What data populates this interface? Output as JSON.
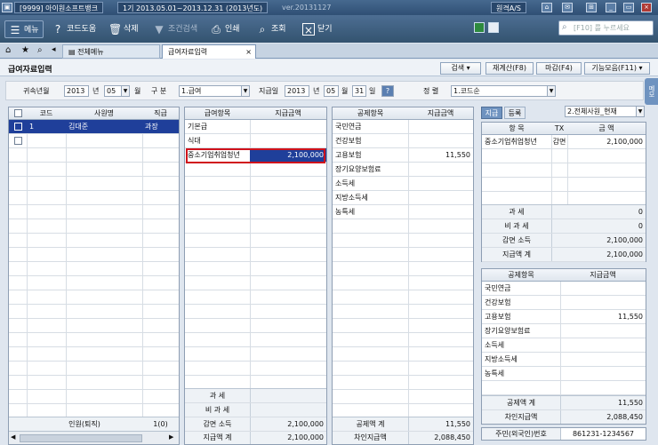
{
  "title_bar": {
    "app_name": "[9999] 아이원소프트뱅크",
    "period": "1기 2013.05.01~2013.12.31 (2013년도)",
    "version": "ver.20131127",
    "support": "원격A/S"
  },
  "toolbar": {
    "menu": "메뉴",
    "code_help": "코드도움",
    "delete": "삭제",
    "condition_search": "조건검색",
    "print": "인쇄",
    "inquiry": "조회",
    "close": "닫기",
    "search_placeholder": "[F10] 를 누르세요"
  },
  "tabs": {
    "all_menu": "전체메뉴",
    "current": "급여자료입력"
  },
  "page": {
    "title": "급여자료입력",
    "buttons": {
      "search": "검색",
      "recalc": "재계산(F8)",
      "deadline": "마감(F4)",
      "functions": "기능모음(F11)"
    },
    "side_tab": "메모"
  },
  "filter": {
    "attr_label": "귀속년월",
    "attr_year": "2013",
    "year_unit": "년",
    "attr_month": "05",
    "month_unit": "월",
    "type_label": "구 분",
    "type_value": "1.급여",
    "pay_label": "지급일",
    "pay_year": "2013",
    "pay_month": "05",
    "pay_day": "31",
    "day_unit": "일",
    "help": "?",
    "sort_label": "정 렬",
    "sort_value": "1.코드순"
  },
  "employee_grid": {
    "headers": [
      "코드",
      "사원명",
      "직급"
    ],
    "rows": [
      {
        "code": "1",
        "name": "김대준",
        "rank": "과장"
      }
    ],
    "footer_label": "인원(퇴직)",
    "footer_value": "1(0)"
  },
  "payment_grid": {
    "headers": [
      "급여항목",
      "지급금액"
    ],
    "rows": [
      {
        "item": "기본급",
        "amount": ""
      },
      {
        "item": "식대",
        "amount": ""
      },
      {
        "item": "중소기업취업청년",
        "amount": "2,100,000"
      }
    ],
    "footer": [
      {
        "label": "과 세",
        "value": ""
      },
      {
        "label": "비 과 세",
        "value": ""
      },
      {
        "label": "감면 소득",
        "value": "2,100,000"
      },
      {
        "label": "지급액 계",
        "value": "2,100,000"
      }
    ]
  },
  "deduction_grid": {
    "headers": [
      "공제항목",
      "지급금액"
    ],
    "rows": [
      {
        "item": "국민연금",
        "amount": ""
      },
      {
        "item": "건강보험",
        "amount": ""
      },
      {
        "item": "고용보험",
        "amount": "11,550"
      },
      {
        "item": "장기요양보험료",
        "amount": ""
      },
      {
        "item": "소득세",
        "amount": ""
      },
      {
        "item": "지방소득세",
        "amount": ""
      },
      {
        "item": "농특세",
        "amount": ""
      }
    ],
    "footer": [
      {
        "label": "공제액 계",
        "value": "11,550"
      },
      {
        "label": "차인지급액",
        "value": "2,088,450"
      }
    ]
  },
  "summary": {
    "tab_current": "지급",
    "tab_history": "등록",
    "mode_value": "2.전체사원_현재",
    "headers": [
      "항 목",
      "TX",
      "금 액"
    ],
    "rows": [
      {
        "item": "중소기업취업청년",
        "tx": "감면",
        "amount": "2,100,000"
      }
    ],
    "totals": [
      {
        "label": "과 세",
        "value": "0"
      },
      {
        "label": "비 과 세",
        "value": "0"
      },
      {
        "label": "감면 소득",
        "value": "2,100,000"
      },
      {
        "label": "지급액 계",
        "value": "2,100,000"
      }
    ],
    "ded_headers": [
      "공제항목",
      "지급금액"
    ],
    "ded_rows": [
      {
        "item": "국민연금",
        "amount": ""
      },
      {
        "item": "건강보험",
        "amount": ""
      },
      {
        "item": "고용보험",
        "amount": "11,550"
      },
      {
        "item": "장기요양보험료",
        "amount": ""
      },
      {
        "item": "소득세",
        "amount": ""
      },
      {
        "item": "지방소득세",
        "amount": ""
      },
      {
        "item": "농특세",
        "amount": ""
      }
    ],
    "ded_totals": [
      {
        "label": "공제액 계",
        "value": "11,550"
      },
      {
        "label": "차인지급액",
        "value": "2,088,450"
      }
    ],
    "resident_label": "주민(외국인)번호",
    "resident_value": "861231-1234567"
  },
  "colors": {
    "toolbar": "#33536f",
    "highlight": "#d0121b",
    "selected_row": "#1f3f9a"
  }
}
